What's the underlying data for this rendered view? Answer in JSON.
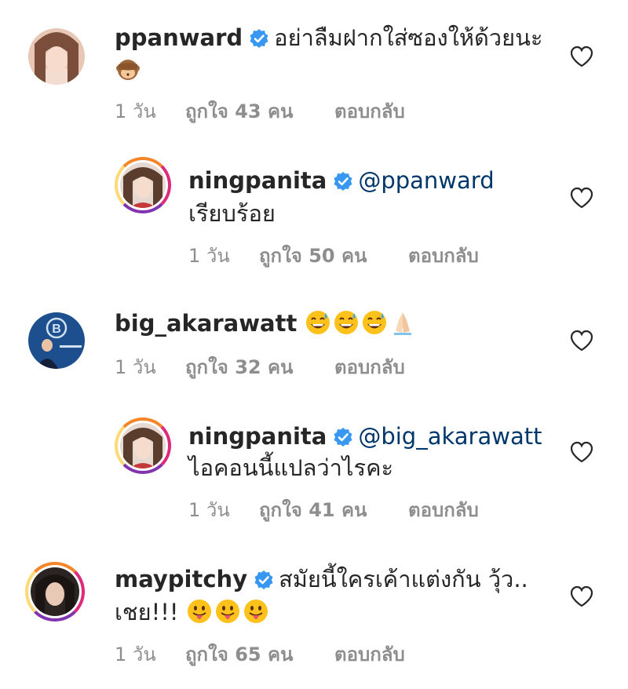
{
  "comments": [
    {
      "username": "ppanward",
      "verified": true,
      "text": "อย่าลืมฝากใส่ซองให้ด้วยนะ",
      "emoji": [
        "see-no-evil-monkey"
      ],
      "time": "1 วัน",
      "likes": "ถูกใจ 43 คน",
      "reply": "ตอบกลับ"
    },
    {
      "username": "ningpanita",
      "verified": true,
      "mention": "@ppanward",
      "text": "เรียบร้อย",
      "time": "1 วัน",
      "likes": "ถูกใจ 50 คน",
      "reply": "ตอบกลับ"
    },
    {
      "username": "big_akarawatt",
      "verified": false,
      "emoji": [
        "grinning-sweat",
        "grinning-sweat",
        "grinning-sweat",
        "folded-hands"
      ],
      "time": "1 วัน",
      "likes": "ถูกใจ 32 คน",
      "reply": "ตอบกลับ"
    },
    {
      "username": "ningpanita",
      "verified": true,
      "mention": "@big_akarawatt",
      "text": "ไอคอนนี้แปลว่าไรคะ",
      "time": "1 วัน",
      "likes": "ถูกใจ 41 คน",
      "reply": "ตอบกลับ"
    },
    {
      "username": "maypitchy",
      "verified": true,
      "text": "สมัยนี้ใครเค้าแต่งกัน วุ้ว..",
      "text2": "เชย!!!",
      "emoji": [
        "tongue-face",
        "tongue-face",
        "tongue-face"
      ],
      "time": "1 วัน",
      "likes": "ถูกใจ 65 คน",
      "reply": "ตอบกลับ"
    }
  ],
  "colors": {
    "username": "#262626",
    "meta": "#8e8e8e",
    "mention": "#00376b",
    "verified": "#3897f0"
  }
}
